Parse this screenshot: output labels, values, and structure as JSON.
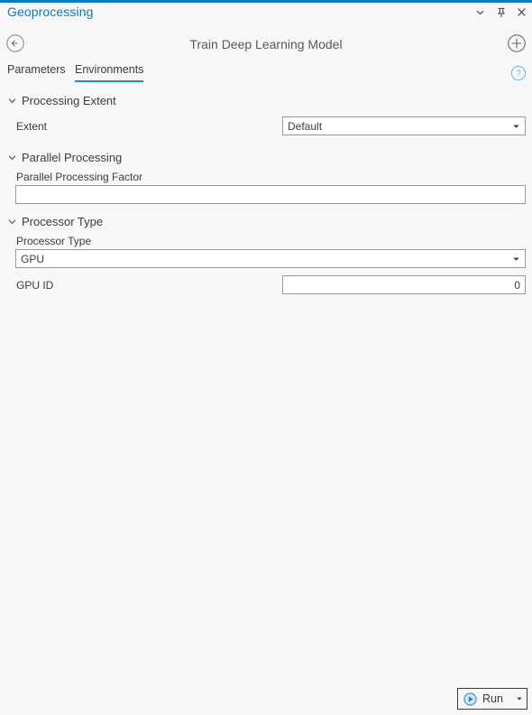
{
  "window": {
    "title": "Geoprocessing",
    "accent_color": "#0a7bbd",
    "controls": [
      {
        "name": "menu-dropdown",
        "icon": "chevron-down-icon"
      },
      {
        "name": "pin",
        "icon": "pin-icon"
      },
      {
        "name": "close",
        "icon": "close-icon"
      }
    ]
  },
  "header": {
    "back_icon": "back-arrow-circle-icon",
    "tool_title": "Train Deep Learning Model",
    "add_icon": "plus-circle-icon"
  },
  "tabs": {
    "items": [
      {
        "label": "Parameters",
        "active": false
      },
      {
        "label": "Environments",
        "active": true
      }
    ],
    "active_underline_color": "#1b8bc4",
    "help_icon": "help-circle-icon"
  },
  "sections": [
    {
      "title": "Processing Extent",
      "expanded": true,
      "fields": [
        {
          "layout": "inline",
          "label": "Extent",
          "control": "dropdown",
          "value": "Default",
          "placeholder": ""
        }
      ]
    },
    {
      "title": "Parallel Processing",
      "expanded": true,
      "fields": [
        {
          "layout": "stacked",
          "label": "Parallel Processing Factor",
          "control": "text",
          "value": "",
          "placeholder": ""
        }
      ]
    },
    {
      "title": "Processor Type",
      "expanded": true,
      "fields": [
        {
          "layout": "stacked",
          "label": "Processor Type",
          "control": "dropdown",
          "value": "GPU",
          "placeholder": ""
        },
        {
          "layout": "inline",
          "label": "GPU ID",
          "control": "text",
          "value": "0",
          "placeholder": "",
          "align": "right"
        }
      ]
    }
  ],
  "footer": {
    "run_label": "Run",
    "run_icon": "play-circle-icon",
    "run_dropdown_icon": "chevron-down-icon"
  }
}
